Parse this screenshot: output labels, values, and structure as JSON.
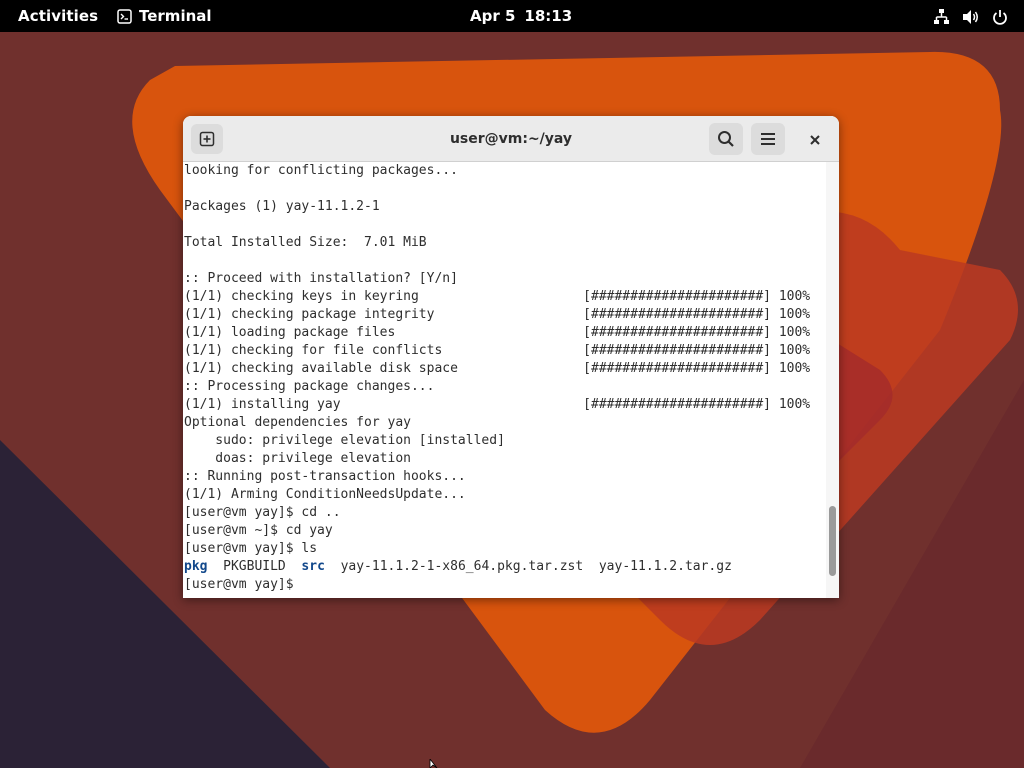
{
  "topbar": {
    "activities_label": "Activities",
    "app_name": "Terminal",
    "app_icon": "terminal-icon",
    "date": "Apr 5",
    "time": "18:13",
    "status_icons": [
      "network-wired-icon",
      "volume-icon",
      "power-icon"
    ]
  },
  "window": {
    "title": "user@vm:~/yay",
    "buttons": {
      "new_tab": "new-tab-icon",
      "search": "search-icon",
      "menu": "hamburger-menu-icon",
      "close": "close-icon"
    },
    "scrollbar": {
      "position": 0.95
    }
  },
  "terminal": {
    "lines": [
      "looking for conflicting packages...",
      "",
      "Packages (1) yay-11.1.2-1",
      "",
      "Total Installed Size:  7.01 MiB",
      "",
      ":: Proceed with installation? [Y/n]",
      "(1/1) checking keys in keyring                     [######################] 100%",
      "(1/1) checking package integrity                   [######################] 100%",
      "(1/1) loading package files                        [######################] 100%",
      "(1/1) checking for file conflicts                  [######################] 100%",
      "(1/1) checking available disk space                [######################] 100%",
      ":: Processing package changes...",
      "(1/1) installing yay                               [######################] 100%",
      "Optional dependencies for yay",
      "    sudo: privilege elevation [installed]",
      "    doas: privilege elevation",
      ":: Running post-transaction hooks...",
      "(1/1) Arming ConditionNeedsUpdate...",
      "[user@vm yay]$ cd ..",
      "[user@vm ~]$ cd yay",
      "[user@vm yay]$ ls"
    ],
    "ls_output": [
      {
        "name": "pkg",
        "type": "dir"
      },
      {
        "name": "PKGBUILD",
        "type": "file"
      },
      {
        "name": "src",
        "type": "dir"
      },
      {
        "name": "yay-11.1.2-1-x86_64.pkg.tar.zst",
        "type": "file"
      },
      {
        "name": "yay-11.1.2.tar.gz",
        "type": "file"
      }
    ],
    "prompt": "[user@vm yay]$ "
  },
  "colors": {
    "topbar_bg": "#000000",
    "wallpaper_base": "#6e2a2a",
    "wallpaper_orange": "#d9540d",
    "wallpaper_dark": "#2b2236",
    "terminal_bg": "#ffffff",
    "terminal_fg": "#2e2e2e",
    "dir_color": "#12488b"
  }
}
